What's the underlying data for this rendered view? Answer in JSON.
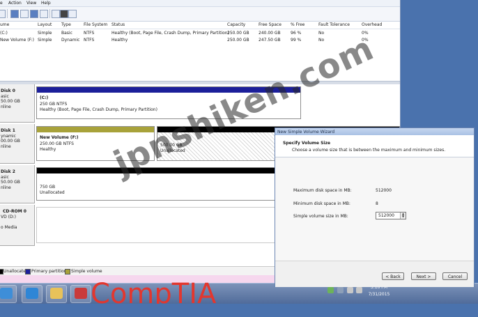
{
  "menu": {
    "items": [
      "e",
      "Action",
      "View",
      "Help"
    ]
  },
  "volumes": {
    "columns": [
      "ume",
      "Layout",
      "Type",
      "File System",
      "Status",
      "Capacity",
      "Free Space",
      "% Free",
      "Fault Tolerance",
      "Overhead"
    ],
    "rows": [
      [
        "(C:)",
        "Simple",
        "Basic",
        "NTFS",
        "Healthy (Boot, Page File, Crash Dump, Primary Partition)",
        "250.00 GB",
        "240.00 GB",
        "96 %",
        "No",
        "0%"
      ],
      [
        "New Volume (F:)",
        "Simple",
        "Dynamic",
        "NTFS",
        "Healthy",
        "250.00 GB",
        "247.50 GB",
        "99 %",
        "No",
        "0%"
      ]
    ]
  },
  "disks": [
    {
      "name": "Disk 0",
      "l1": "asic",
      "l2": "50.00 GB",
      "l3": "nline",
      "partitions": [
        {
          "title": "(C:)",
          "line2": "250 GB NTFS",
          "line3": "Healthy (Boot, Page File, Crash Dump, Primary Partition)",
          "color": "#1c1f9a"
        }
      ]
    },
    {
      "name": "Disk 1",
      "l1": "ynamic",
      "l2": "00.00 GB",
      "l3": "nline",
      "partitions": [
        {
          "title": "New Volume (F:)",
          "line2": "250.00 GB NTFS",
          "line3": "Healthy",
          "color": "#a8a23a"
        },
        {
          "title": "",
          "line2": "500.00 GB",
          "line3": "Unallocated",
          "color": "#000000"
        }
      ]
    },
    {
      "name": "Disk 2",
      "l1": "asic",
      "l2": "50.00 GB",
      "l3": "nline",
      "partitions": [
        {
          "title": "",
          "line2": "750 GB",
          "line3": "Unallocated",
          "color": "#000000"
        }
      ]
    },
    {
      "name": "CD-ROM 0",
      "l1": "VD (D:)",
      "l2": "",
      "l3": "o Media",
      "partitions": []
    }
  ],
  "legend": {
    "unallocated": "Unallocated",
    "primary": "Primary partition",
    "simple": "Simple volume"
  },
  "wizard": {
    "window_title": "New Simple Volume Wizard",
    "heading": "Specify Volume Size",
    "subheading": "Choose a volume size that is between the maximum and minimum sizes.",
    "fields": [
      {
        "label": "Maximum disk space in MB:",
        "value": "512000"
      },
      {
        "label": "Minimum disk space in MB:",
        "value": "8"
      }
    ],
    "size_label": "Simple volume size in MB:",
    "size_value": "512000",
    "back": "< Back",
    "next": "Next >",
    "cancel": "Cancel"
  },
  "taskbar": {
    "time": "5:10 PM",
    "date": "7/31/2015"
  },
  "overlay": {
    "brand": "CompTIA",
    "watermark": "jpnshiken.com"
  },
  "colors": {
    "desktop": "#4a72ad",
    "primary": "#1c1f9a",
    "simple": "#a8a23a",
    "unallocated": "#000000",
    "brand": "#e2372f"
  }
}
